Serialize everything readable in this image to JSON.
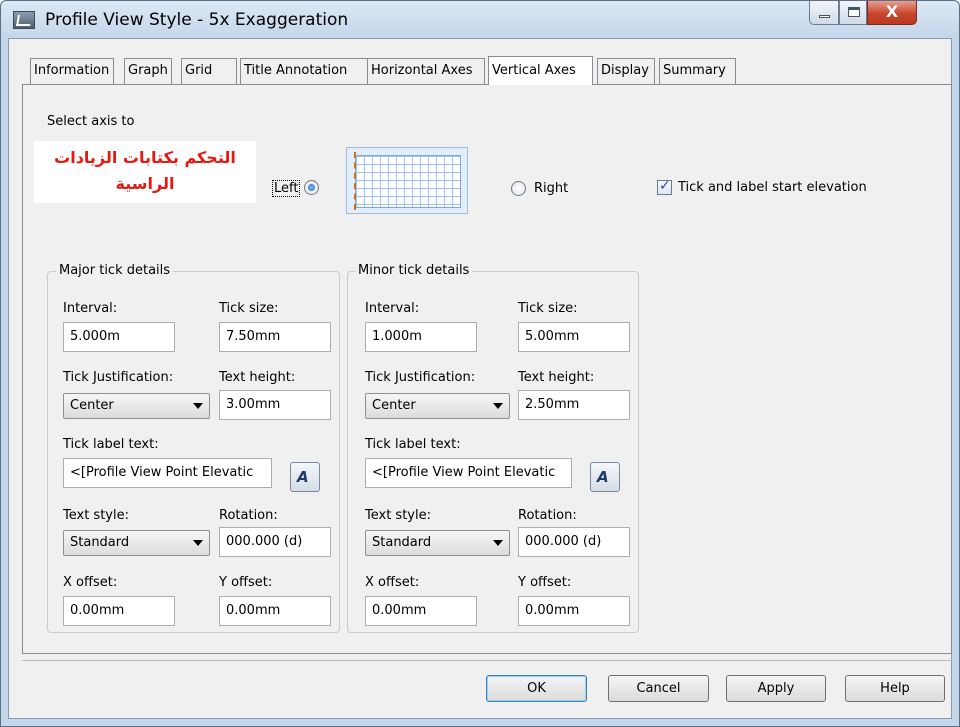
{
  "window": {
    "title": "Profile View Style - 5x Exaggeration"
  },
  "tabs": [
    {
      "label": "Information"
    },
    {
      "label": "Graph"
    },
    {
      "label": "Grid"
    },
    {
      "label": "Title Annotation"
    },
    {
      "label": "Horizontal Axes"
    },
    {
      "label": "Vertical Axes"
    },
    {
      "label": "Display"
    },
    {
      "label": "Summary"
    }
  ],
  "active_tab": "Vertical Axes",
  "select_axis": {
    "label": "Select axis to",
    "annotation_line1": "التحكم بكتابات الزيادات",
    "annotation_line2": "الراسية",
    "left_label": "Left",
    "right_label": "Right",
    "selected": "Left",
    "tick_start_label": "Tick and label start elevation",
    "tick_start_checked": true
  },
  "major": {
    "title": "Major tick details",
    "interval_label": "Interval:",
    "interval": "5.000m",
    "tick_size_label": "Tick size:",
    "tick_size": "7.50mm",
    "justification_label": "Tick Justification:",
    "justification": "Center",
    "text_height_label": "Text height:",
    "text_height": "3.00mm",
    "tick_label_text_label": "Tick label text:",
    "tick_label_text": "<[Profile View Point Elevatic",
    "text_style_label": "Text style:",
    "text_style": "Standard",
    "rotation_label": "Rotation:",
    "rotation": "000.000 (d)",
    "x_offset_label": "X offset:",
    "x_offset": "0.00mm",
    "y_offset_label": "Y offset:",
    "y_offset": "0.00mm"
  },
  "minor": {
    "title": "Minor tick details",
    "interval_label": "Interval:",
    "interval": "1.000m",
    "tick_size_label": "Tick size:",
    "tick_size": "5.00mm",
    "justification_label": "Tick Justification:",
    "justification": "Center",
    "text_height_label": "Text height:",
    "text_height": "2.50mm",
    "tick_label_text_label": "Tick label text:",
    "tick_label_text": "<[Profile View Point Elevatic",
    "text_style_label": "Text style:",
    "text_style": "Standard",
    "rotation_label": "Rotation:",
    "rotation": "000.000 (d)",
    "x_offset_label": "X offset:",
    "x_offset": "0.00mm",
    "y_offset_label": "Y offset:",
    "y_offset": "0.00mm"
  },
  "buttons": {
    "ok": "OK",
    "cancel": "Cancel",
    "apply": "Apply",
    "help": "Help"
  },
  "icons": {
    "app": "civil-3d-app-icon",
    "edit_text": "text-component-editor-icon"
  },
  "colors": {
    "annotation": "#e8170f",
    "tick_marks": "#d46a1a",
    "grid_lines": "#9ec3f0"
  }
}
